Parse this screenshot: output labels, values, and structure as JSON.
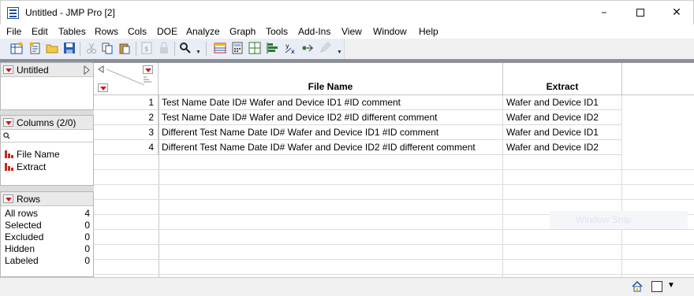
{
  "window": {
    "title": "Untitled - JMP Pro [2]"
  },
  "menu": [
    "File",
    "Edit",
    "Tables",
    "Rows",
    "Cols",
    "DOE",
    "Analyze",
    "Graph",
    "Tools",
    "Add-Ins",
    "View",
    "Window",
    "Help"
  ],
  "left_panel": {
    "table_name": "Untitled",
    "columns_header": "Columns (2/0)",
    "columns": [
      "File Name",
      "Extract"
    ],
    "rows_header": "Rows",
    "rows_stats": [
      {
        "label": "All rows",
        "value": "4"
      },
      {
        "label": "Selected",
        "value": "0"
      },
      {
        "label": "Excluded",
        "value": "0"
      },
      {
        "label": "Hidden",
        "value": "0"
      },
      {
        "label": "Labeled",
        "value": "0"
      }
    ]
  },
  "table": {
    "headers": [
      "File Name",
      "Extract"
    ],
    "rows": [
      {
        "num": "1",
        "file_name": "Test Name Date ID# Wafer and Device ID1 #ID comment",
        "extract": "Wafer and Device ID1"
      },
      {
        "num": "2",
        "file_name": "Test Name Date ID# Wafer and Device ID2 #ID different comment",
        "extract": "Wafer and Device ID2"
      },
      {
        "num": "3",
        "file_name": "Different Test Name Date ID# Wafer and Device ID1 #ID comment",
        "extract": "Wafer and Device ID1"
      },
      {
        "num": "4",
        "file_name": "Different Test Name Date ID# Wafer and Device ID2 #ID different comment",
        "extract": "Wafer and Device ID2"
      }
    ]
  },
  "overlay": {
    "ghost_text": "Window Snip"
  },
  "colors": {
    "accent_red": "#d0151b",
    "toolbar_bg": "#e9edf6",
    "column_icon": "#c8281e"
  }
}
